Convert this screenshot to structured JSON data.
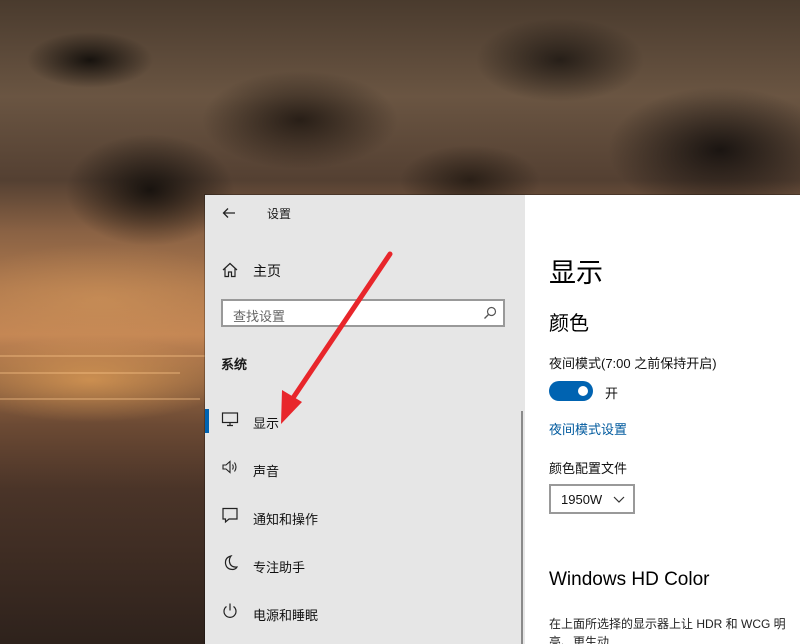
{
  "window": {
    "title": "设置"
  },
  "nav": {
    "home_label": "主页",
    "search_placeholder": "查找设置",
    "group_title": "系统",
    "items": [
      {
        "label": "显示",
        "icon": "monitor-icon",
        "selected": true
      },
      {
        "label": "声音",
        "icon": "speaker-icon",
        "selected": false
      },
      {
        "label": "通知和操作",
        "icon": "notification-icon",
        "selected": false
      },
      {
        "label": "专注助手",
        "icon": "moon-icon",
        "selected": false
      },
      {
        "label": "电源和睡眠",
        "icon": "power-icon",
        "selected": false
      }
    ]
  },
  "content": {
    "page_title": "显示",
    "section_title": "颜色",
    "night_light_label": "夜间模式(7:00 之前保持开启)",
    "toggle_state": "开",
    "toggle_on": true,
    "night_settings_link": "夜间模式设置",
    "color_profile_label": "颜色配置文件",
    "color_profile_value": "1950W",
    "hd_color_title": "Windows HD Color",
    "hd_color_desc": "在上面所选择的显示器上让 HDR 和 WCG 明亮、更生动"
  },
  "colors": {
    "accent": "#0063b1",
    "link": "#005a9e",
    "annotation_arrow": "#e8262b"
  }
}
